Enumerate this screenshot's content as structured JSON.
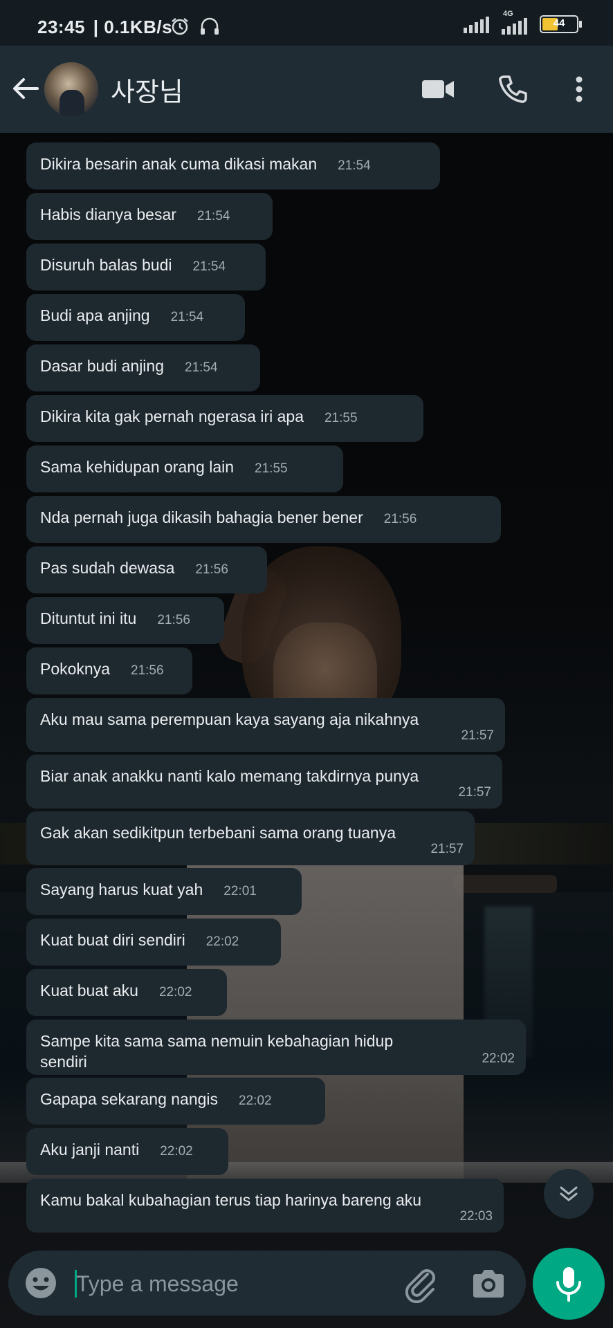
{
  "status_bar": {
    "time": "23:45",
    "net_speed": "| 0.1KB/s",
    "network_type": "4G",
    "battery_level": "44",
    "icons": [
      "alarm-icon",
      "headset-icon",
      "signal-icon",
      "signal-4g-icon",
      "battery-icon"
    ]
  },
  "header": {
    "contact_name": "사장님",
    "icons": [
      "back-arrow-icon",
      "video-call-icon",
      "voice-call-icon",
      "more-options-icon"
    ]
  },
  "messages": [
    {
      "text": "Dikira besarin anak cuma dikasi makan",
      "time": "21:54"
    },
    {
      "text": "Habis dianya besar",
      "time": "21:54"
    },
    {
      "text": "Disuruh balas budi",
      "time": "21:54"
    },
    {
      "text": "Budi apa anjing",
      "time": "21:54"
    },
    {
      "text": "Dasar budi anjing",
      "time": "21:54"
    },
    {
      "text": "Dikira kita gak pernah ngerasa iri apa",
      "time": "21:55"
    },
    {
      "text": "Sama kehidupan orang lain",
      "time": "21:55"
    },
    {
      "text": "Nda pernah juga dikasih bahagia bener bener",
      "time": "21:56"
    },
    {
      "text": "Pas sudah dewasa",
      "time": "21:56"
    },
    {
      "text": "Dituntut ini itu",
      "time": "21:56"
    },
    {
      "text": "Pokoknya",
      "time": "21:56"
    },
    {
      "text": "Aku mau sama perempuan kaya sayang aja nikahnya",
      "time": "21:57"
    },
    {
      "text": "Biar anak anakku nanti kalo memang takdirnya punya",
      "time": "21:57"
    },
    {
      "text": "Gak akan sedikitpun terbebani sama orang tuanya",
      "time": "21:57"
    },
    {
      "text": "Sayang harus kuat yah",
      "time": "22:01"
    },
    {
      "text": "Kuat buat diri sendiri",
      "time": "22:02"
    },
    {
      "text": "Kuat buat aku",
      "time": "22:02"
    },
    {
      "text": "Sampe kita sama sama nemuin kebahagian hidup sendiri",
      "time": "22:02"
    },
    {
      "text": "Gapapa sekarang nangis",
      "time": "22:02"
    },
    {
      "text": "Aku janji nanti",
      "time": "22:02"
    },
    {
      "text": "Kamu bakal kubahagian terus tiap harinya bareng aku",
      "time": "22:03"
    }
  ],
  "composer": {
    "placeholder": "Type a message",
    "value": "",
    "icons": [
      "emoji-icon",
      "attach-icon",
      "camera-icon",
      "mic-icon",
      "scroll-down-icon"
    ]
  },
  "colors": {
    "header_bg": "#1f2c34",
    "bubble_bg": "#1e282f",
    "accent": "#00a884",
    "battery_fill": "#f1c232"
  }
}
